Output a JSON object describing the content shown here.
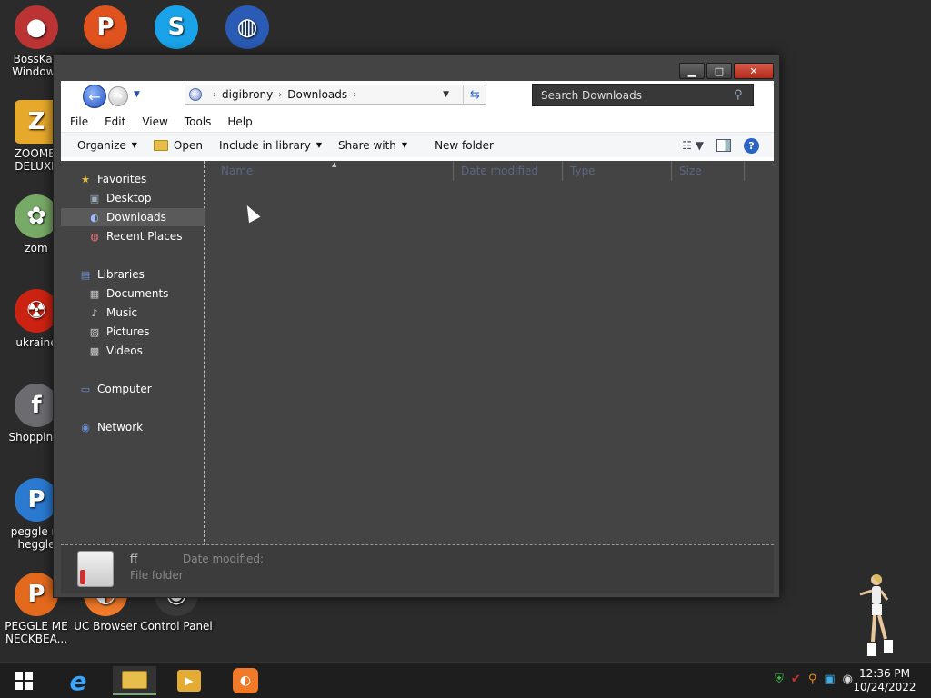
{
  "desktop": {
    "icons": [
      {
        "label": "BossKan\nWindows",
        "glyph": "●",
        "color": "#b33"
      },
      {
        "label": "ZOOMEI\nDELUXE",
        "glyph": "Z",
        "color": "#e7a92b"
      },
      {
        "label": "zom",
        "glyph": "✿",
        "color": "#7a6"
      },
      {
        "label": "ukraine",
        "glyph": "☢",
        "color": "#c21"
      },
      {
        "label": "Shopping(",
        "glyph": "f",
        "color": "#6b6b70"
      },
      {
        "label": "peggle m\nheggle",
        "glyph": "P",
        "color": "#2a7ad1"
      },
      {
        "label": "PEGGLE ME\nNECKBEA...",
        "glyph": "P",
        "color": "#e36a1d"
      },
      {
        "label": "UC Browser",
        "glyph": "◐",
        "color": "#f07a28"
      },
      {
        "label": "Control Panel",
        "glyph": "◉",
        "color": "#3a3a3a"
      },
      {
        "label": "",
        "glyph": "P",
        "color": "#e0531f"
      },
      {
        "label": "",
        "glyph": "S",
        "color": "#1aa3e8"
      },
      {
        "label": "",
        "glyph": "◍",
        "color": "#2a5bb5"
      }
    ]
  },
  "window": {
    "caption": {
      "minimize": "▁",
      "maximize": "□",
      "close": "✕"
    },
    "address": {
      "crumbs": [
        "digibrony",
        "Downloads"
      ]
    },
    "search": {
      "placeholder": "Search Downloads"
    },
    "menu": [
      "File",
      "Edit",
      "View",
      "Tools",
      "Help"
    ],
    "commands": {
      "organize": "Organize",
      "open": "Open",
      "include": "Include in library",
      "share": "Share with",
      "new_folder": "New folder"
    },
    "columns": [
      "Name",
      "Date modified",
      "Type",
      "Size"
    ],
    "nav": {
      "favorites": "Favorites",
      "desktop": "Desktop",
      "downloads": "Downloads",
      "recent": "Recent Places",
      "libraries": "Libraries",
      "documents": "Documents",
      "music": "Music",
      "pictures": "Pictures",
      "videos": "Videos",
      "computer": "Computer",
      "network": "Network"
    },
    "details": {
      "name": "ff",
      "type": "File folder",
      "modified_label": "Date modified:"
    }
  },
  "taskbar": {
    "clock_time": "12:36 PM",
    "clock_date": "10/24/2022"
  }
}
